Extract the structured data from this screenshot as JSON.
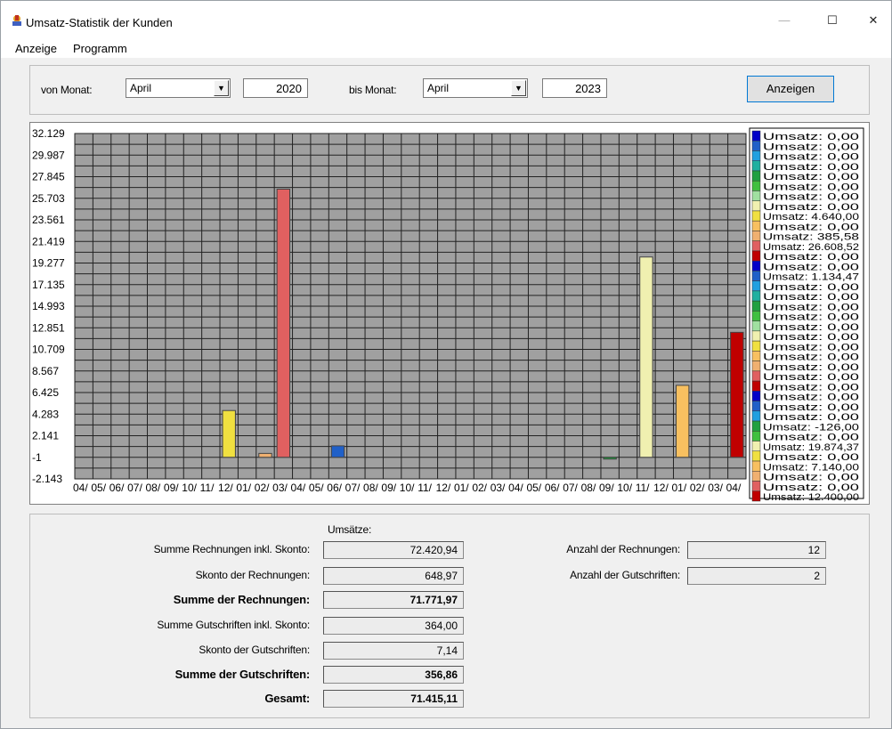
{
  "window": {
    "title": "Umsatz-Statistik der Kunden",
    "minimize": "—",
    "maximize": "☐",
    "close": "✕"
  },
  "menu": [
    "Anzeige",
    "Programm"
  ],
  "filter": {
    "von_label": "von Monat:",
    "von_month": "April",
    "von_year": "2020",
    "bis_label": "bis Monat:",
    "bis_month": "April",
    "bis_year": "2023",
    "button": "Anzeigen"
  },
  "chart_data": {
    "type": "bar",
    "y_ticks": [
      "32.129",
      "29.987",
      "27.845",
      "25.703",
      "23.561",
      "21.419",
      "19.277",
      "17.135",
      "14.993",
      "12.851",
      "10.709",
      "8.567",
      "6.425",
      "4.283",
      "2.141",
      "-1",
      "-2.143"
    ],
    "y_tick_values": [
      32129,
      29987,
      27845,
      25703,
      23561,
      21419,
      19277,
      17135,
      14993,
      12851,
      10709,
      8567,
      6425,
      4283,
      2141,
      -1,
      -2143
    ],
    "x_labels": [
      "04/",
      "05/",
      "06/",
      "07/",
      "08/",
      "09/",
      "10/",
      "11/",
      "12/",
      "01/",
      "02/",
      "03/",
      "04/",
      "05/",
      "06/",
      "07/",
      "08/",
      "09/",
      "10/",
      "11/",
      "12/",
      "01/",
      "02/",
      "03/",
      "04/",
      "05/",
      "06/",
      "07/",
      "08/",
      "09/",
      "10/",
      "11/",
      "12/",
      "01/",
      "02/",
      "03/",
      "04/"
    ],
    "ylim": [
      -2143,
      32129
    ],
    "grid": true,
    "legend_position": "right",
    "plot_bg": "#a0a0a0",
    "values": [
      0,
      0,
      0,
      0,
      0,
      0,
      0,
      0,
      4640,
      0,
      385.58,
      26608.52,
      0,
      0,
      1134.47,
      0,
      0,
      0,
      0,
      0,
      0,
      0,
      0,
      0,
      0,
      0,
      0,
      0,
      0,
      -126,
      0,
      19874.37,
      0,
      7140,
      0,
      0,
      12400
    ],
    "colors": [
      "#0000c8",
      "#2060c8",
      "#20a0e0",
      "#20b0a0",
      "#20a040",
      "#40c040",
      "#a0e0a0",
      "#f0f0b0",
      "#f0e040",
      "#f8c060",
      "#f0b070",
      "#e06060",
      "#c00000",
      "#0000c8",
      "#2060c8",
      "#20a0e0",
      "#20b0a0",
      "#20a040",
      "#40c040",
      "#a0e0a0",
      "#f0f0b0",
      "#f0e040",
      "#f8c060",
      "#f0b070",
      "#e06060",
      "#c00000",
      "#0000c8",
      "#2060c8",
      "#20a0e0",
      "#20a040",
      "#40c040",
      "#f0f0b0",
      "#f0e040",
      "#f8c060",
      "#f0b070",
      "#e06060",
      "#c00000"
    ],
    "legend": [
      "Umsatz: 0,00",
      "Umsatz: 0,00",
      "Umsatz: 0,00",
      "Umsatz: 0,00",
      "Umsatz: 0,00",
      "Umsatz: 0,00",
      "Umsatz: 0,00",
      "Umsatz: 0,00",
      "Umsatz: 4.640,00",
      "Umsatz: 0,00",
      "Umsatz: 385,58",
      "Umsatz: 26.608,52",
      "Umsatz: 0,00",
      "Umsatz: 0,00",
      "Umsatz: 1.134,47",
      "Umsatz: 0,00",
      "Umsatz: 0,00",
      "Umsatz: 0,00",
      "Umsatz: 0,00",
      "Umsatz: 0,00",
      "Umsatz: 0,00",
      "Umsatz: 0,00",
      "Umsatz: 0,00",
      "Umsatz: 0,00",
      "Umsatz: 0,00",
      "Umsatz: 0,00",
      "Umsatz: 0,00",
      "Umsatz: 0,00",
      "Umsatz: 0,00",
      "Umsatz: -126,00",
      "Umsatz: 0,00",
      "Umsatz: 19.874,37",
      "Umsatz: 0,00",
      "Umsatz: 7.140,00",
      "Umsatz: 0,00",
      "Umsatz: 0,00",
      "Umsatz: 12.400,00"
    ],
    "legend_colors": [
      "#0000c8",
      "#2060c8",
      "#20a0e0",
      "#20b0a0",
      "#20a040",
      "#40c040",
      "#a0e0a0",
      "#f0f0b0",
      "#f0e040",
      "#f8c060",
      "#f0b070",
      "#e06060",
      "#c00000",
      "#0000c8",
      "#2060c8",
      "#20a0e0",
      "#20b0a0",
      "#20a040",
      "#40c040",
      "#a0e0a0",
      "#f0f0b0",
      "#f0e040",
      "#f8c060",
      "#f0b070",
      "#e06060",
      "#c00000",
      "#0000c8",
      "#2060c8",
      "#20a0e0",
      "#20a040",
      "#40c040",
      "#f0f0b0",
      "#f0e040",
      "#f8c060",
      "#f0b070",
      "#e06060",
      "#c00000"
    ]
  },
  "summary": {
    "header": "Umsätze:",
    "rows": [
      {
        "label": "Summe  Rechnungen inkl. Skonto:",
        "value": "72.420,94"
      },
      {
        "label": "Skonto der Rechnungen:",
        "value": "648,97"
      },
      {
        "label": "Summe der Rechnungen:",
        "value": "71.771,97"
      },
      {
        "label": "Summe Gutschriften inkl. Skonto:",
        "value": "364,00"
      },
      {
        "label": "Skonto der Gutschriften:",
        "value": "7,14"
      },
      {
        "label": "Summe der Gutschriften:",
        "value": "356,86"
      },
      {
        "label": "Gesamt:",
        "value": "71.415,11"
      }
    ],
    "count_rechnungen_label": "Anzahl der Rechnungen:",
    "count_rechnungen": "12",
    "count_gutschriften_label": "Anzahl der Gutschriften:",
    "count_gutschriften": "2"
  }
}
